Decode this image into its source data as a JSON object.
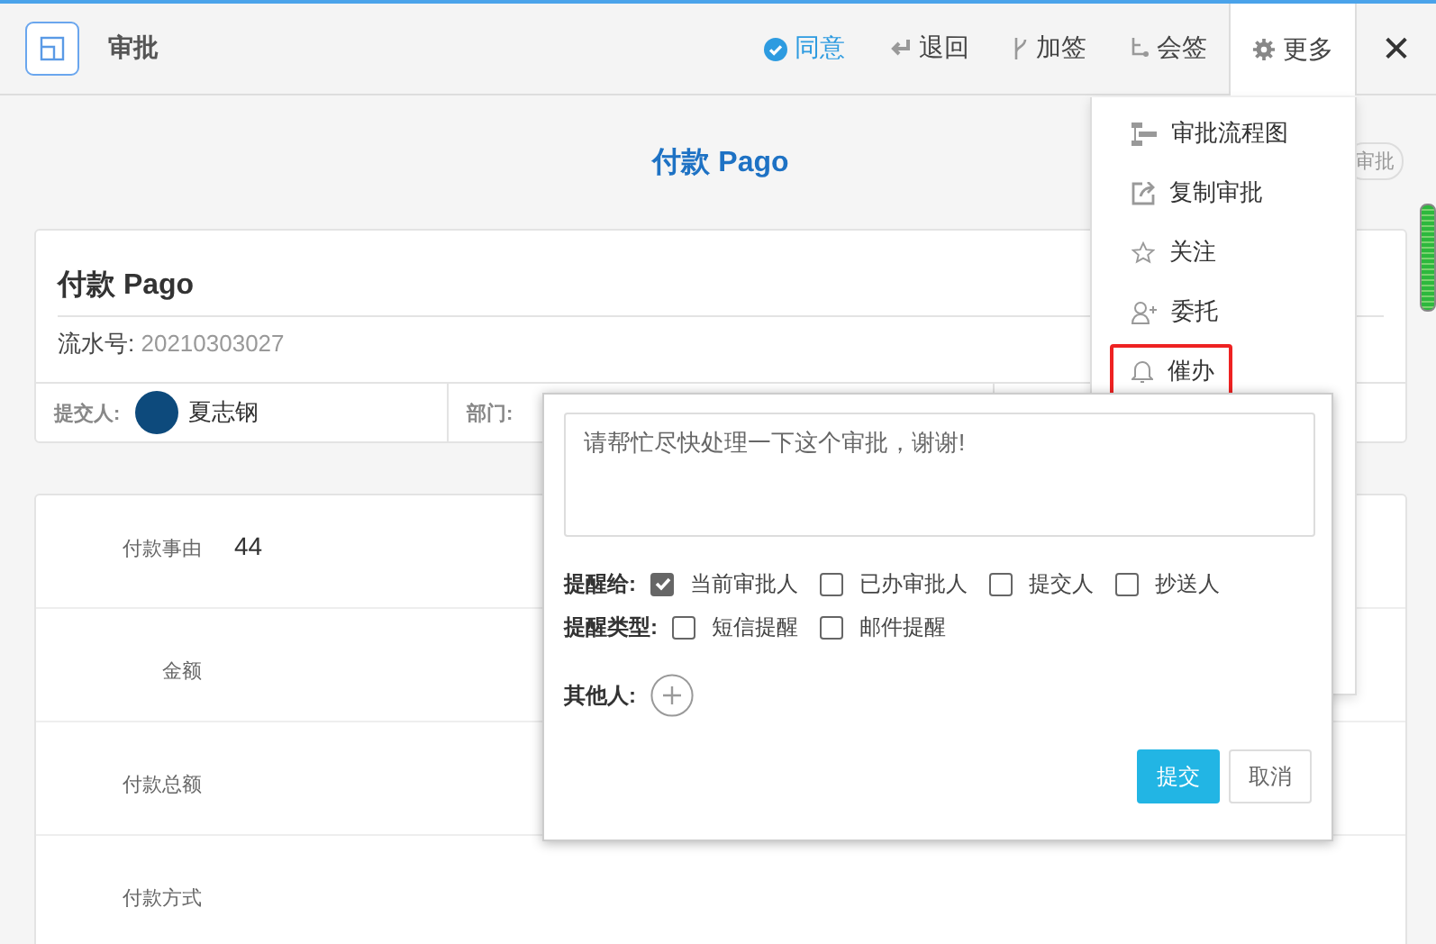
{
  "window": {
    "title": "审批"
  },
  "toolbar": {
    "actions": [
      {
        "label": "同意",
        "kind": "approve"
      },
      {
        "label": "退回",
        "kind": "return"
      },
      {
        "label": "加签",
        "kind": "branch"
      },
      {
        "label": "会签",
        "kind": "merge"
      },
      {
        "label": "更多",
        "kind": "more",
        "selected": true
      }
    ],
    "close": "✕"
  },
  "form_title": "付款 Pago",
  "tag": "审批",
  "summary": {
    "title": "付款 Pago",
    "serial_label": "流水号:",
    "serial": "20210303027",
    "fields": [
      {
        "label": "提交人:",
        "value": "夏志钢",
        "kind": "person"
      },
      {
        "label": "部门:",
        "kind": "text"
      }
    ]
  },
  "rows": [
    {
      "label": "付款事由",
      "value": "44"
    },
    {
      "label": "金额"
    },
    {
      "label": "付款总额"
    },
    {
      "label": "付款方式"
    }
  ],
  "more_menu": [
    {
      "label": "审批流程图",
      "kind": "flow",
      "selected": false
    },
    {
      "label": "复制审批",
      "kind": "copy",
      "selected": false
    },
    {
      "label": "关注",
      "kind": "star",
      "selected": false
    },
    {
      "label": "委托",
      "kind": "user",
      "selected": false
    },
    {
      "label": "催办",
      "kind": "bell",
      "selected": true
    }
  ],
  "remind_popup": {
    "placeholder": "请帮忙尽快处理一下这个审批，谢谢!",
    "groups": [
      {
        "label": "提醒给:",
        "options": [
          {
            "label": "当前审批人",
            "checked": true
          },
          {
            "label": "已办审批人",
            "checked": false
          },
          {
            "label": "提交人",
            "checked": false
          },
          {
            "label": "抄送人",
            "checked": false
          }
        ]
      },
      {
        "label": "提醒类型:",
        "options": [
          {
            "label": "短信提醒",
            "checked": false
          },
          {
            "label": "邮件提醒",
            "checked": false
          }
        ]
      }
    ],
    "others_label": "其他人:",
    "buttons": [
      {
        "label": "提交",
        "kind": "primary"
      },
      {
        "label": "取消",
        "kind": "default"
      }
    ]
  }
}
